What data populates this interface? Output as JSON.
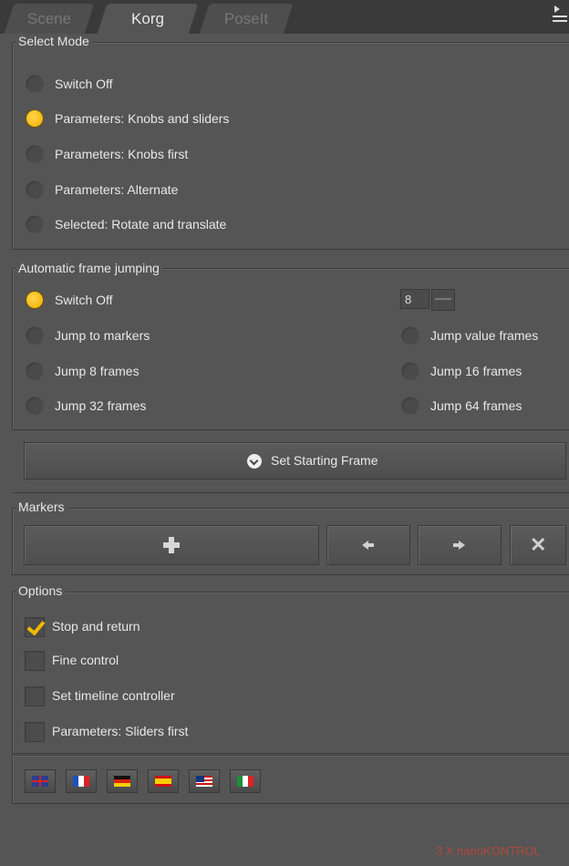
{
  "tabs": [
    {
      "label": "Scene"
    },
    {
      "label": "Korg"
    },
    {
      "label": "PoseIt"
    }
  ],
  "select_mode": {
    "title": "Select Mode",
    "options": [
      {
        "label": "Switch Off",
        "selected": false
      },
      {
        "label": "Parameters: Knobs and sliders",
        "selected": true
      },
      {
        "label": "Parameters: Knobs first",
        "selected": false
      },
      {
        "label": "Parameters: Alternate",
        "selected": false
      },
      {
        "label": "Selected: Rotate and translate",
        "selected": false
      }
    ]
  },
  "frame_jumping": {
    "title": "Automatic frame jumping",
    "value_field": "8",
    "options": [
      {
        "label": "Switch Off",
        "selected": true
      },
      {
        "label": "Jump to markers",
        "selected": false
      },
      {
        "label": "Jump value frames",
        "selected": false
      },
      {
        "label": "Jump 8 frames",
        "selected": false
      },
      {
        "label": "Jump 16 frames",
        "selected": false
      },
      {
        "label": "Jump 32 frames",
        "selected": false
      },
      {
        "label": "Jump 64 frames",
        "selected": false
      }
    ],
    "set_starting_frame_label": "Set Starting Frame"
  },
  "markers": {
    "title": "Markers",
    "buttons": [
      "add-icon",
      "arrow-left-icon",
      "arrow-right-icon",
      "close-icon"
    ]
  },
  "options": {
    "title": "Options",
    "items": [
      {
        "label": "Stop and return",
        "checked": true
      },
      {
        "label": "Fine control",
        "checked": false
      },
      {
        "label": "Set timeline controller",
        "checked": false
      },
      {
        "label": "Parameters: Sliders first",
        "checked": false
      }
    ]
  },
  "languages": [
    "uk-flag-icon",
    "france-flag-icon",
    "germany-flag-icon",
    "spain-flag-icon",
    "malaysia-flag-icon",
    "italy-flag-icon"
  ],
  "footer": {
    "text": "3 X nanoKONTROL"
  },
  "colors": {
    "accent": "#f5b800",
    "footer_text": "#b04a3a"
  }
}
